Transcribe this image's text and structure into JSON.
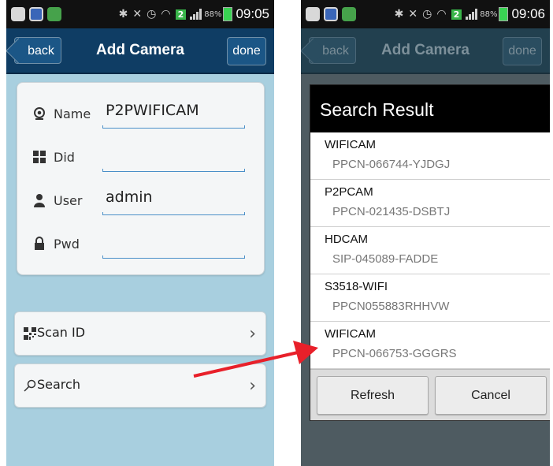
{
  "left": {
    "status": {
      "time": "09:05",
      "battery": "88%",
      "badge": "2"
    },
    "titlebar": {
      "back": "back",
      "title": "Add Camera",
      "done": "done"
    },
    "form": {
      "name": {
        "label": "Name",
        "value": "P2PWIFICAM",
        "icon": "webcam-icon"
      },
      "did": {
        "label": "Did",
        "value": "",
        "icon": "grid-icon"
      },
      "user": {
        "label": "User",
        "value": "admin",
        "icon": "user-icon"
      },
      "pwd": {
        "label": "Pwd",
        "value": "",
        "icon": "lock-icon"
      }
    },
    "scan_id": {
      "label": "Scan ID",
      "icon": "qr-code-icon"
    },
    "search": {
      "label": "Search",
      "icon": "search-icon"
    }
  },
  "right": {
    "status": {
      "time": "09:06",
      "battery": "88%",
      "badge": "2"
    },
    "titlebar": {
      "back": "back",
      "title": "Add Camera",
      "done": "done"
    },
    "dialog": {
      "title": "Search Result",
      "results": [
        {
          "name": "WIFICAM",
          "id": "PPCN-066744-YJDGJ"
        },
        {
          "name": "P2PCAM",
          "id": "PPCN-021435-DSBTJ"
        },
        {
          "name": "HDCAM",
          "id": "SIP-045089-FADDE"
        },
        {
          "name": "S3518-WIFI",
          "id": "PPCN055883RHHVW"
        },
        {
          "name": "WIFICAM",
          "id": "PPCN-066753-GGGRS"
        }
      ],
      "refresh": "Refresh",
      "cancel": "Cancel"
    }
  },
  "colors": {
    "titlebar": "#0f3d64",
    "background": "#a8cfdf",
    "arrow": "#e8202a"
  }
}
